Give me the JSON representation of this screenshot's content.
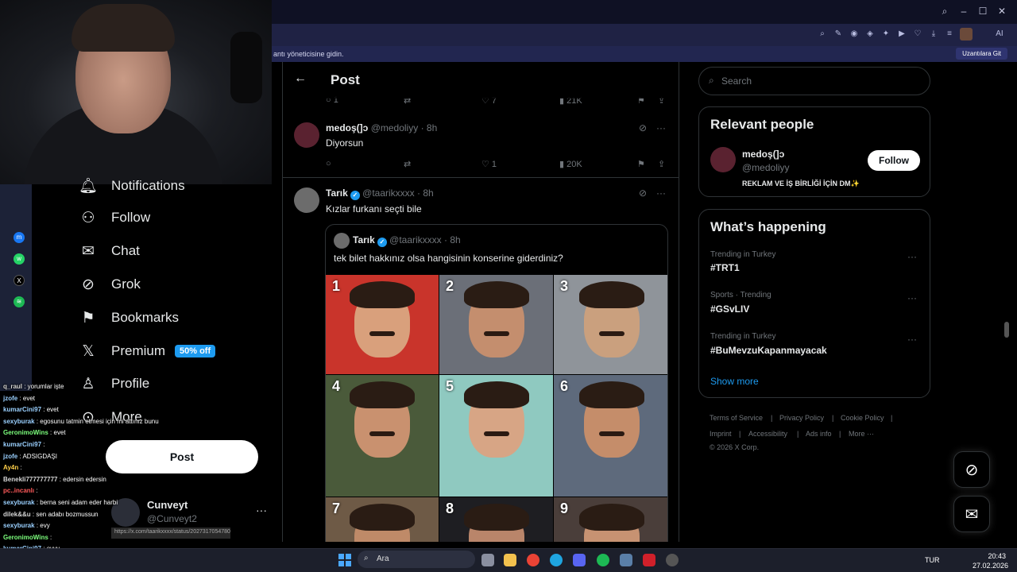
{
  "browser": {
    "infobar_text": "antı yöneticisine gidin.",
    "infobar_button": "Uzantılara Git"
  },
  "nav": {
    "items": [
      {
        "label": "Notifications",
        "icon": "bell-icon"
      },
      {
        "label": "Follow",
        "icon": "add-person-icon"
      },
      {
        "label": "Chat",
        "icon": "envelope-icon"
      },
      {
        "label": "Grok",
        "icon": "grok-icon"
      },
      {
        "label": "Bookmarks",
        "icon": "bookmark-icon"
      },
      {
        "label": "Premium",
        "icon": "x-logo-icon",
        "badge": "50% off"
      },
      {
        "label": "Profile",
        "icon": "person-icon"
      },
      {
        "label": "More",
        "icon": "more-circle-icon"
      }
    ],
    "post_button": "Post",
    "account": {
      "name": "Cunveyt",
      "handle": "@Cunveyt2"
    }
  },
  "chat": [
    {
      "user": "q_raul",
      "text": " : yorumlar işte",
      "color": "#d6d6d6"
    },
    {
      "user": "jzofe",
      "text": " : evet",
      "color": "#9ad0ff"
    },
    {
      "user": "kumarCini97",
      "text": " : evet",
      "color": "#9ad0ff"
    },
    {
      "user": "sexyburak",
      "text": " : egosunu tatmin etmesi için mi attınız bunu",
      "color": "#9ad0ff"
    },
    {
      "user": "GeronimoWins",
      "text": " : evet",
      "color": "#7cff7c"
    },
    {
      "user": "kumarCini97",
      "text": " : ",
      "color": "#9ad0ff"
    },
    {
      "user": "jzofe",
      "text": " : ADSIGDAŞI",
      "color": "#9ad0ff"
    },
    {
      "user": "Ay4n",
      "text": " : ",
      "color": "#ffd04a"
    },
    {
      "user": "Benekli777777777",
      "text": " : edersin edersin",
      "color": "#d6d6d6"
    },
    {
      "user": "pc..incanlı",
      "text": " : ",
      "color": "#ff5a5a"
    },
    {
      "user": "sexyburak",
      "text": " : berna seni adam eder harbi",
      "color": "#9ad0ff"
    },
    {
      "user": "dilek&&u",
      "text": " : sen adabı bozmussun",
      "color": "#d6d6d6"
    },
    {
      "user": "sexyburak",
      "text": " : evy",
      "color": "#9ad0ff"
    },
    {
      "user": "GeronimoWins",
      "text": " : ",
      "color": "#7cff7c"
    },
    {
      "user": "kumarCini97",
      "text": " : oyyy",
      "color": "#9ad0ff"
    }
  ],
  "url_tip": "https://x.com/taarikxxxx/status/2027317054780493485/photo/1",
  "main": {
    "header_title": "Post",
    "top_actions": {
      "replies": "1",
      "likes": "7",
      "views": "21K"
    },
    "reply1": {
      "name": "medoş(]ɔ",
      "handle": "@medoliyy",
      "time": "· 8h",
      "text": "Diyorsun",
      "likes": "1",
      "views": "20K"
    },
    "tweet": {
      "name": "Tarık",
      "handle": "@taarikxxxx",
      "time": "· 8h",
      "text": "Kızlar furkanı seçti bile"
    },
    "quote": {
      "name": "Tarık",
      "handle": "@taarikxxxx",
      "time": "· 8h",
      "text": "tek bilet hakkınız olsa hangisinin konserine giderdiniz?",
      "numbers": [
        "1",
        "2",
        "3",
        "4",
        "5",
        "6",
        "7",
        "8",
        "9"
      ]
    }
  },
  "right": {
    "search_placeholder": "Search",
    "relevant_title": "Relevant people",
    "person": {
      "name": "medoş(]ɔ",
      "handle": "@medoliyy",
      "bio": "REKLAM VE İŞ BİRLİĞİ İÇİN DM✨"
    },
    "follow_button": "Follow",
    "happening_title": "What’s happening",
    "trends": [
      {
        "category": "Trending in Turkey",
        "name": "#TRT1"
      },
      {
        "category": "Sports · Trending",
        "name": "#GSvLIV"
      },
      {
        "category": "Trending in Turkey",
        "name": "#BuMevzuKapanmayacak"
      }
    ],
    "show_more": "Show more",
    "footer": [
      "Terms of Service",
      "|",
      "Privacy Policy",
      "|",
      "Cookie Policy",
      "|",
      "Imprint",
      "|",
      "Accessibility",
      "|",
      "Ads info",
      "|",
      "More ···",
      "© 2026 X Corp."
    ]
  },
  "taskbar": {
    "search_placeholder": "Ara",
    "lang": "TUR",
    "time": "20:43",
    "date": "27.02.2026"
  }
}
